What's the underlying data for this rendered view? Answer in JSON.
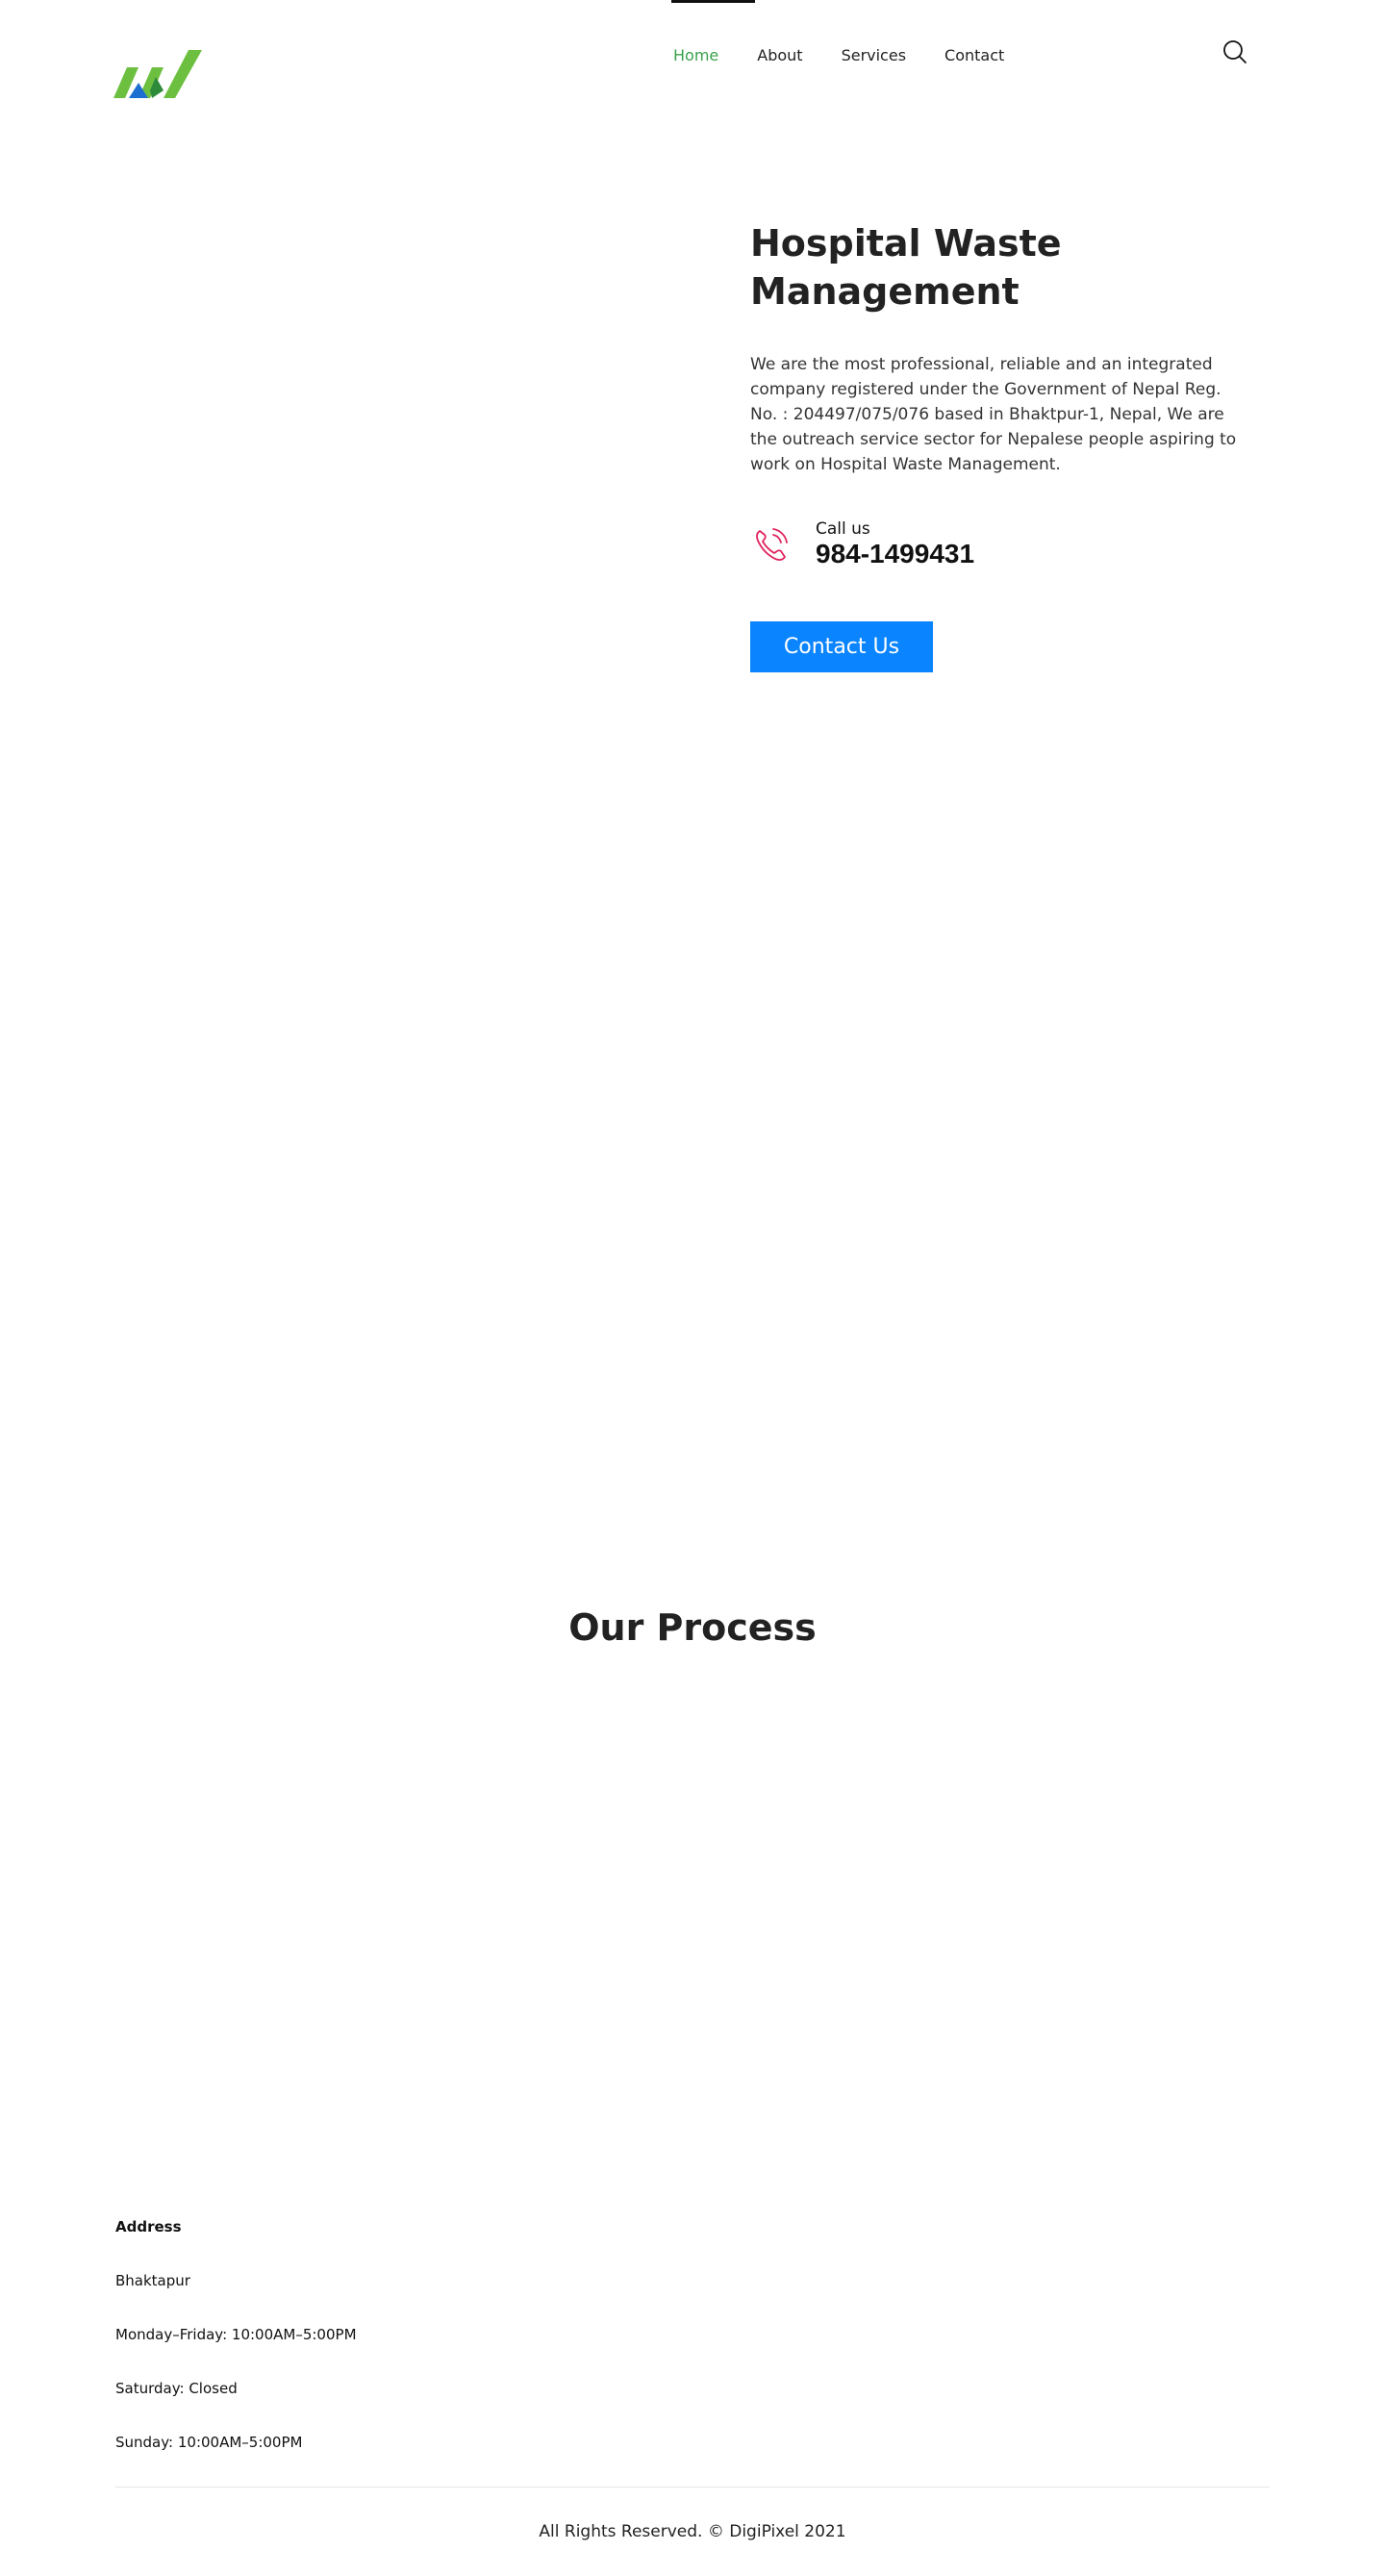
{
  "nav": {
    "items": [
      {
        "label": "Home"
      },
      {
        "label": "About"
      },
      {
        "label": "Services"
      },
      {
        "label": "Contact"
      }
    ],
    "active_index": 0
  },
  "icons": {
    "logo": "logo-mark",
    "search": "search-icon",
    "phone": "phone-icon"
  },
  "hero": {
    "title": "Hospital Waste Management",
    "description": "We are the most professional, reliable and an integrated company registered under the Government of Nepal Reg. No. : 204497/075/076 based in Bhaktpur-1, Nepal, We are the outreach service sector for Nepalese people aspiring to work on Hospital Waste Management.",
    "call_label": "Call us",
    "call_number": "984-1499431",
    "cta_label": "Contact Us"
  },
  "process": {
    "title": "Our Process"
  },
  "footer": {
    "address_heading": "Address",
    "address": "Bhaktapur",
    "hours": [
      "Monday–Friday: 10:00AM–5:00PM",
      "Saturday: Closed",
      "Sunday: 10:00AM–5:00PM"
    ],
    "copyright": "All Rights Reserved. © DigiPixel 2021"
  },
  "colors": {
    "accent_green": "#3aa14b",
    "logo_blue": "#1c6fd1",
    "button_blue": "#0a84ff",
    "phone_red": "#e0245e"
  }
}
